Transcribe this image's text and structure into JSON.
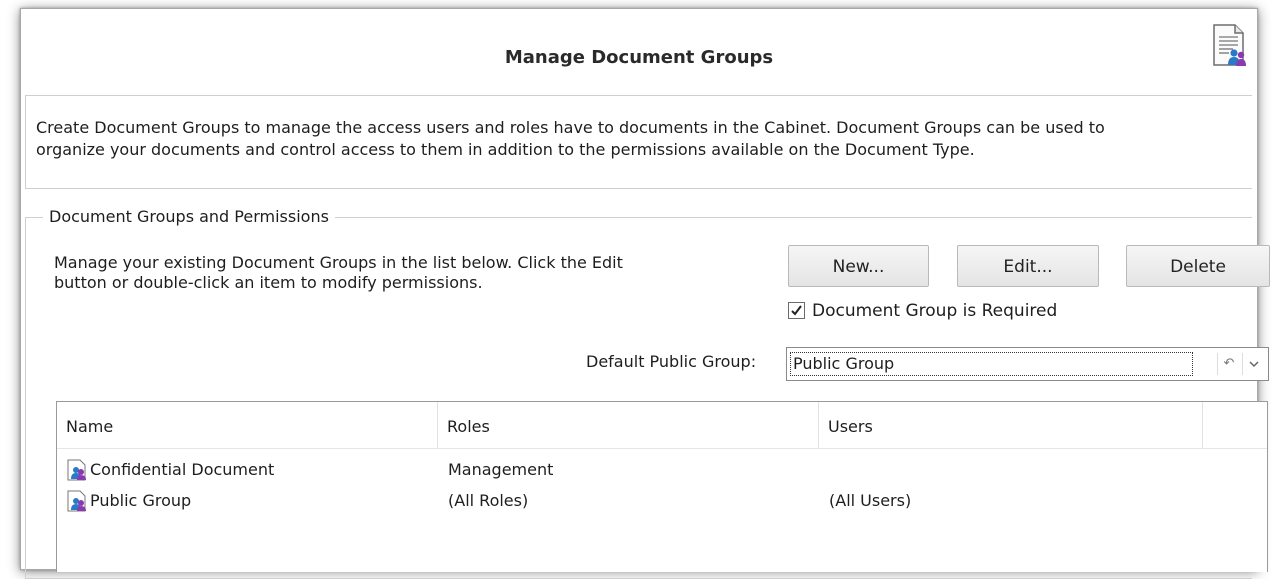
{
  "dialog": {
    "title": "Manage Document Groups",
    "header_icon": "document-users-icon",
    "description_line1": "Create Document Groups to manage the access users and roles have to documents in the Cabinet.  Document Groups can be used to",
    "description_line2": "organize your documents and control access to them in addition to the permissions available on the Document Type."
  },
  "group": {
    "legend": "Document Groups and Permissions",
    "manage_line1": "Manage your existing Document Groups in the list below.  Click the Edit",
    "manage_line2": "button or double-click an item to modify permissions.",
    "buttons": {
      "new": "New...",
      "edit": "Edit...",
      "delete": "Delete"
    },
    "required_checkbox": {
      "label": "Document Group is Required",
      "checked": true
    },
    "default_public_label": "Default Public Group:",
    "default_public_value": "Public Group"
  },
  "list": {
    "columns": [
      "Name",
      "Roles",
      "Users"
    ],
    "rows": [
      {
        "name": "Confidential Document",
        "roles": "Management",
        "users": ""
      },
      {
        "name": "Public Group",
        "roles": "(All Roles)",
        "users": "(All Users)"
      }
    ]
  },
  "colors": {
    "accent_purple": "#6a4aa0",
    "border": "#cfcfcf"
  }
}
